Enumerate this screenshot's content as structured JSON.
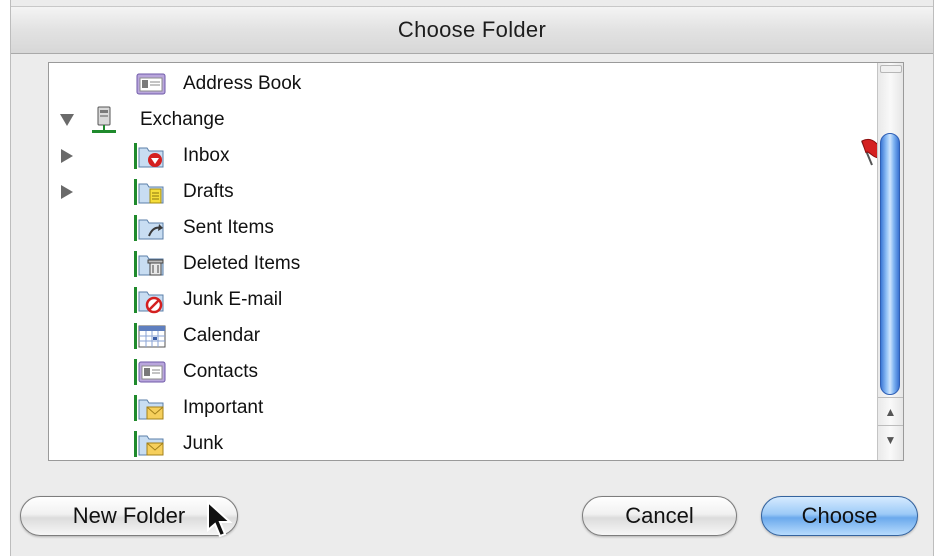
{
  "dialog": {
    "title": "Choose Folder"
  },
  "folders": [
    {
      "label": "Address Book",
      "icon": "address-book-icon",
      "disclosure": "none",
      "indent": 1
    },
    {
      "label": "Exchange",
      "icon": "exchange-server-icon",
      "disclosure": "expanded",
      "indent": 0
    },
    {
      "label": "Inbox",
      "icon": "inbox-folder-icon",
      "disclosure": "collapsed",
      "indent": 1
    },
    {
      "label": "Drafts",
      "icon": "drafts-folder-icon",
      "disclosure": "collapsed",
      "indent": 1
    },
    {
      "label": "Sent Items",
      "icon": "sent-items-folder-icon",
      "disclosure": "none",
      "indent": 1
    },
    {
      "label": "Deleted Items",
      "icon": "deleted-items-folder-icon",
      "disclosure": "none",
      "indent": 1
    },
    {
      "label": "Junk E-mail",
      "icon": "junk-email-folder-icon",
      "disclosure": "none",
      "indent": 1
    },
    {
      "label": "Calendar",
      "icon": "calendar-folder-icon",
      "disclosure": "none",
      "indent": 1
    },
    {
      "label": "Contacts",
      "icon": "contacts-folder-icon",
      "disclosure": "none",
      "indent": 1
    },
    {
      "label": "Important",
      "icon": "mail-folder-icon",
      "disclosure": "none",
      "indent": 1
    },
    {
      "label": "Junk",
      "icon": "mail-folder-icon",
      "disclosure": "none",
      "indent": 1
    }
  ],
  "buttons": {
    "new_folder": "New Folder",
    "cancel": "Cancel",
    "choose": "Choose"
  },
  "colors": {
    "accent": "#6ba9ec",
    "flag": "#d42020"
  }
}
